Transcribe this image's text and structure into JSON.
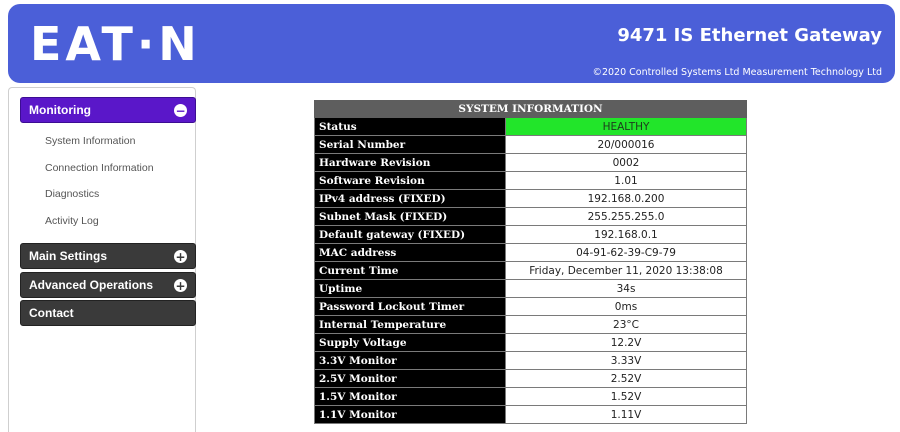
{
  "header": {
    "logo_text": "EAT·N",
    "title": "9471 IS Ethernet Gateway",
    "copyright": "©2020 Controlled Systems Ltd Measurement Technology Ltd"
  },
  "sidebar": {
    "monitoring": {
      "label": "Monitoring",
      "toggle_icon": "−",
      "items": [
        "System Information",
        "Connection Information",
        "Diagnostics",
        "Activity Log"
      ]
    },
    "main_settings": {
      "label": "Main Settings",
      "toggle_icon": "+"
    },
    "advanced_operations": {
      "label": "Advanced Operations",
      "toggle_icon": "+"
    },
    "contact": {
      "label": "Contact"
    }
  },
  "system_info": {
    "title": "SYSTEM INFORMATION",
    "rows": [
      {
        "key": "Status",
        "value": "HEALTHY"
      },
      {
        "key": "Serial Number",
        "value": "20/000016"
      },
      {
        "key": "Hardware Revision",
        "value": "0002"
      },
      {
        "key": "Software Revision",
        "value": "1.01"
      },
      {
        "key": "IPv4 address (FIXED)",
        "value": "192.168.0.200"
      },
      {
        "key": "Subnet Mask (FIXED)",
        "value": "255.255.255.0"
      },
      {
        "key": "Default gateway (FIXED)",
        "value": "192.168.0.1"
      },
      {
        "key": "MAC address",
        "value": "04-91-62-39-C9-79"
      },
      {
        "key": "Current Time",
        "value": "Friday, December 11, 2020 13:38:08"
      },
      {
        "key": "Uptime",
        "value": "34s"
      },
      {
        "key": "Password Lockout Timer",
        "value": "0ms"
      },
      {
        "key": "Internal Temperature",
        "value": "23°C"
      },
      {
        "key": "Supply Voltage",
        "value": "12.2V"
      },
      {
        "key": "3.3V Monitor",
        "value": "3.33V"
      },
      {
        "key": "2.5V Monitor",
        "value": "2.52V"
      },
      {
        "key": "1.5V Monitor",
        "value": "1.52V"
      },
      {
        "key": "1.1V Monitor",
        "value": "1.11V"
      }
    ]
  },
  "colors": {
    "header_bg": "#4b5fd8",
    "menu_active": "#5a17c9",
    "menu_dark": "#3a3a3a",
    "status_healthy": "#22e52a"
  }
}
